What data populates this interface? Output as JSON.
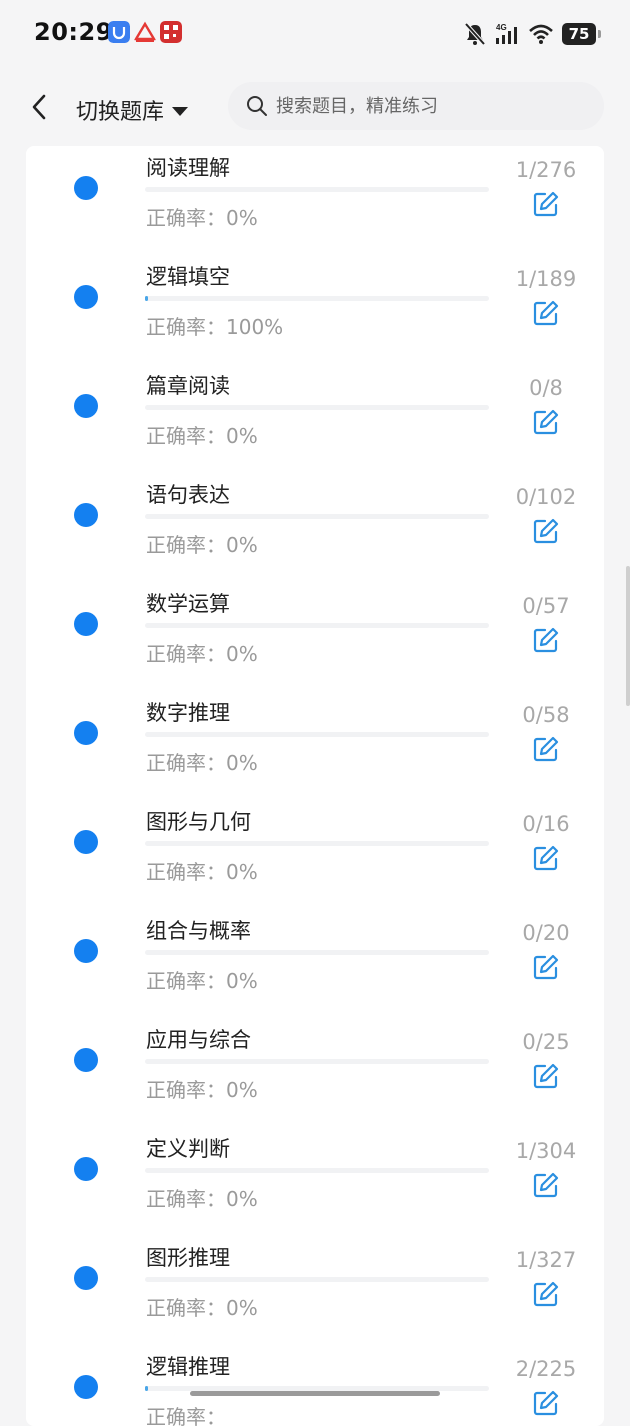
{
  "status_bar": {
    "time": "20:29",
    "battery": "75",
    "network": "4G",
    "icons": [
      "app-shield-icon",
      "app-logo-icon",
      "app-qr-icon",
      "mute-icon",
      "signal-icon",
      "wifi-icon",
      "battery-icon"
    ],
    "colors": {
      "app1": "#3a7ef0",
      "app2": "#e53935",
      "app3": "#d32f2f"
    }
  },
  "header": {
    "back_icon": "chevron-left-icon",
    "bank_title": "切换题库",
    "search_placeholder": "搜索题目，精准练习"
  },
  "colors": {
    "accent": "#1480f0",
    "progress": "#4aa6e8",
    "edit_icon": "#2a8fe0"
  },
  "items": [
    {
      "name": "阅读理解",
      "accuracy_label": "正确率：",
      "accuracy": "0%",
      "count": "1/276",
      "progress": 0
    },
    {
      "name": "逻辑填空",
      "accuracy_label": "正确率：",
      "accuracy": "100%",
      "count": "1/189",
      "progress": 0.005
    },
    {
      "name": "篇章阅读",
      "accuracy_label": "正确率：",
      "accuracy": "0%",
      "count": "0/8",
      "progress": 0
    },
    {
      "name": "语句表达",
      "accuracy_label": "正确率：",
      "accuracy": "0%",
      "count": "0/102",
      "progress": 0
    },
    {
      "name": "数学运算",
      "accuracy_label": "正确率：",
      "accuracy": "0%",
      "count": "0/57",
      "progress": 0
    },
    {
      "name": "数字推理",
      "accuracy_label": "正确率：",
      "accuracy": "0%",
      "count": "0/58",
      "progress": 0
    },
    {
      "name": "图形与几何",
      "accuracy_label": "正确率：",
      "accuracy": "0%",
      "count": "0/16",
      "progress": 0
    },
    {
      "name": "组合与概率",
      "accuracy_label": "正确率：",
      "accuracy": "0%",
      "count": "0/20",
      "progress": 0
    },
    {
      "name": "应用与综合",
      "accuracy_label": "正确率：",
      "accuracy": "0%",
      "count": "0/25",
      "progress": 0
    },
    {
      "name": "定义判断",
      "accuracy_label": "正确率：",
      "accuracy": "0%",
      "count": "1/304",
      "progress": 0
    },
    {
      "name": "图形推理",
      "accuracy_label": "正确率：",
      "accuracy": "0%",
      "count": "1/327",
      "progress": 0
    },
    {
      "name": "逻辑推理",
      "accuracy_label": "正确率：",
      "accuracy": "",
      "count": "2/225",
      "progress": 0.009
    }
  ]
}
